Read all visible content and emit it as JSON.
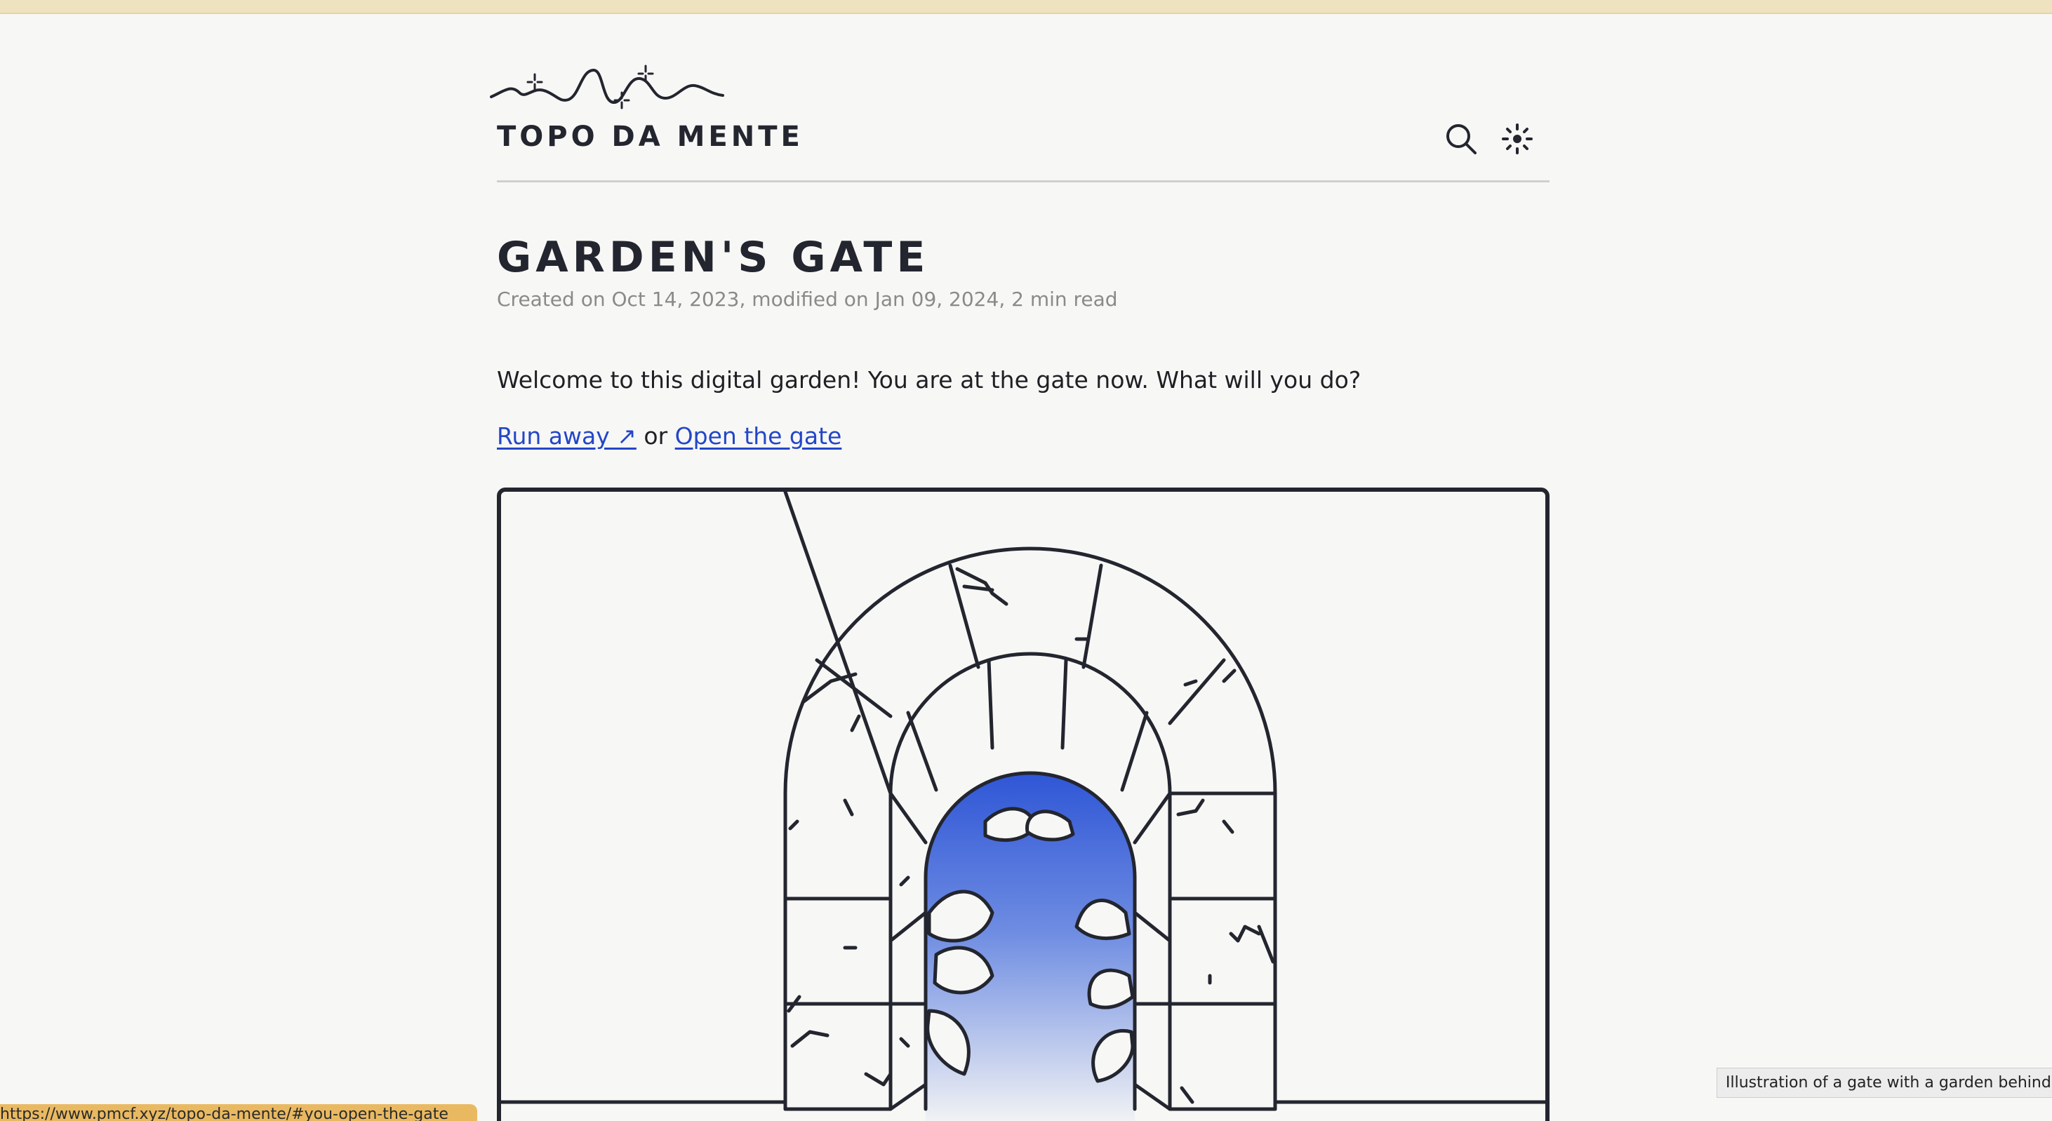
{
  "site": {
    "name": "TOPO DA MENTE"
  },
  "header": {
    "search_icon": "search-icon",
    "theme_icon": "sun-icon"
  },
  "page": {
    "title": "GARDEN'S GATE",
    "meta": "Created on Oct 14, 2023, modified on Jan 09, 2024, 2 min read",
    "intro": "Welcome to this digital garden! You are at the gate now. What will you do?",
    "choice": {
      "run_away_label": "Run away ↗",
      "separator": "or",
      "open_gate_label": "Open the gate"
    }
  },
  "illustration": {
    "tooltip": "Illustration of a gate with a garden behind it",
    "accent": "#2f56d6"
  },
  "status_bar": {
    "url": "https://www.pmcf.xyz/topo-da-mente/#you-open-the-gate"
  },
  "colors": {
    "ink": "#23252f",
    "background": "#f7f7f5",
    "link": "#2346c8",
    "topbar": "#efe3bf",
    "status": "#e9b962"
  }
}
